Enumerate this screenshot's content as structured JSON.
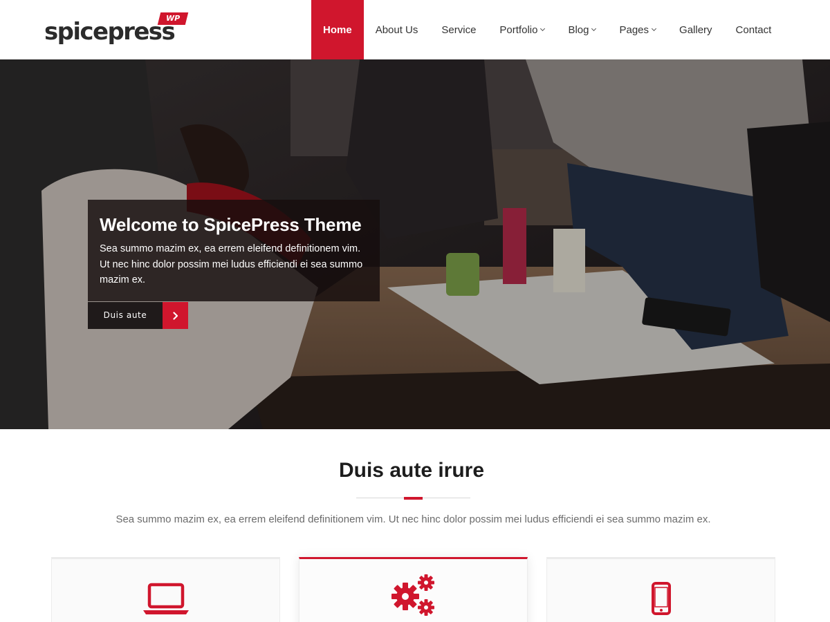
{
  "brand": {
    "name": "spicepress",
    "badge": "WP",
    "accent": "#d0162d"
  },
  "nav": {
    "items": [
      {
        "label": "Home",
        "active": true,
        "dropdown": false
      },
      {
        "label": "About Us",
        "active": false,
        "dropdown": false
      },
      {
        "label": "Service",
        "active": false,
        "dropdown": false
      },
      {
        "label": "Portfolio",
        "active": false,
        "dropdown": true
      },
      {
        "label": "Blog",
        "active": false,
        "dropdown": true
      },
      {
        "label": "Pages",
        "active": false,
        "dropdown": true
      },
      {
        "label": "Gallery",
        "active": false,
        "dropdown": false
      },
      {
        "label": "Contact",
        "active": false,
        "dropdown": false
      }
    ]
  },
  "hero": {
    "title": "Welcome to SpicePress Theme",
    "description": "Sea summo mazim ex, ea errem eleifend definitionem vim. Ut nec hinc dolor possim mei ludus efficiendi ei sea summo mazim ex.",
    "button_label": "Duis aute",
    "button_icon": "chevron-right-icon"
  },
  "section": {
    "title": "Duis aute irure",
    "description": "Sea summo mazim ex, ea errem eleifend definitionem vim. Ut nec hinc dolor possim mei ludus efficiendi ei sea summo mazim ex."
  },
  "cards": [
    {
      "icon": "laptop-icon"
    },
    {
      "icon": "gears-icon"
    },
    {
      "icon": "mobile-phone-icon"
    }
  ]
}
